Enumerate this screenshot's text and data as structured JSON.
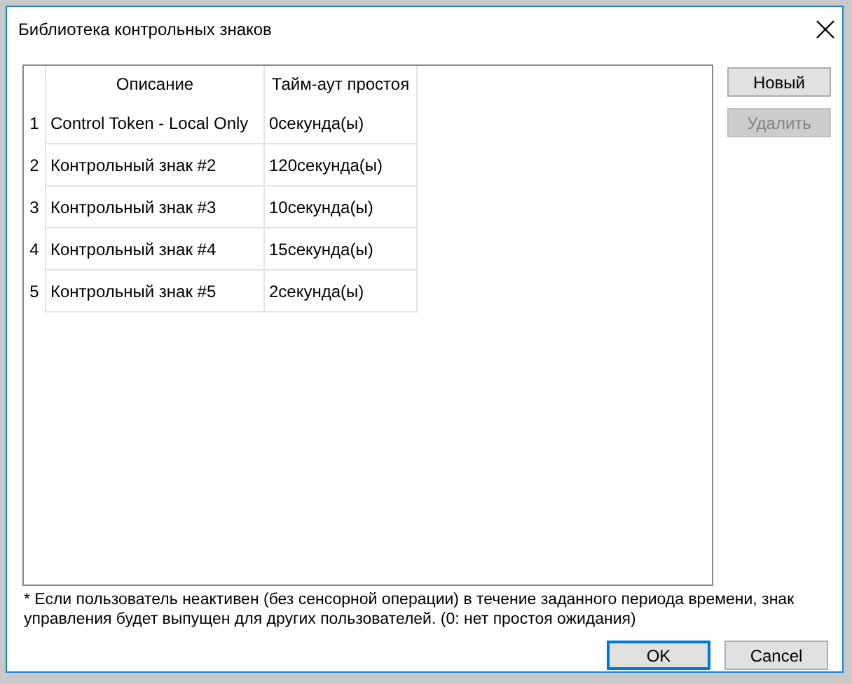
{
  "window": {
    "title": "Библиотека контрольных знаков"
  },
  "table": {
    "columns": [
      "Описание",
      "Тайм-аут простоя"
    ],
    "rows": [
      {
        "number": "1",
        "cells": [
          "Control Token - Local Only",
          "0секунда(ы)"
        ]
      },
      {
        "number": "2",
        "cells": [
          "Контрольный знак #2",
          "120секунда(ы)"
        ]
      },
      {
        "number": "3",
        "cells": [
          "Контрольный знак #3",
          "10секунда(ы)"
        ]
      },
      {
        "number": "4",
        "cells": [
          "Контрольный знак #4",
          "15секунда(ы)"
        ]
      },
      {
        "number": "5",
        "cells": [
          "Контрольный знак #5",
          "2секунда(ы)"
        ]
      }
    ]
  },
  "side_buttons": [
    {
      "label": "Новый",
      "disabled": false
    },
    {
      "label": "Удалить",
      "disabled": true
    }
  ],
  "footnote": "* Если пользователь неактивен (без сенсорной операции) в течение заданного периода времени, знак управления будет выпущен для других пользователей. (0: нет простоя ожидания)",
  "buttons": [
    {
      "label": "OK",
      "default": true
    },
    {
      "label": "Cancel",
      "default": false
    }
  ]
}
